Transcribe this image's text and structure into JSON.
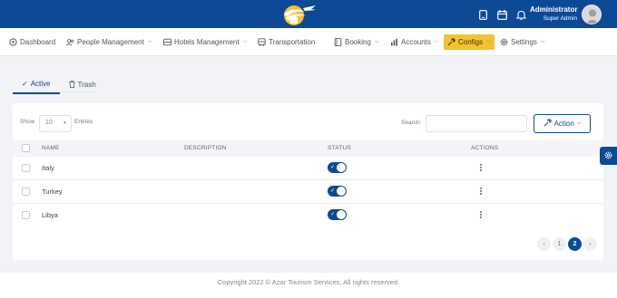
{
  "user": {
    "name": "Administrator",
    "role": "Super Admin"
  },
  "nav": {
    "dashboard": "Dashboard",
    "people": "People Management",
    "hotels": "Hotels Management",
    "transport": "Transportation",
    "booking": "Booking",
    "accounts": "Accounts",
    "configs": "Configs",
    "settings": "Settings"
  },
  "tabs": {
    "active": "Active",
    "trash": "Trash"
  },
  "table_controls": {
    "show_label": "Show",
    "show_value": "10",
    "entries_label": "Entries",
    "search_label": "Search:",
    "search_value": "",
    "action_label": "Action"
  },
  "columns": {
    "name": "NAME",
    "description": "DESCRIPTION",
    "status": "STATUS",
    "actions": "ACTIONS"
  },
  "rows": [
    {
      "name": "Italy",
      "description": "",
      "status": "on"
    },
    {
      "name": "Turkey",
      "description": "",
      "status": "on"
    },
    {
      "name": "Libya",
      "description": "",
      "status": "on"
    }
  ],
  "pagination": {
    "page1": "1",
    "page2": "2",
    "prev": "‹",
    "next": "›"
  },
  "footer": "Copyright 2022 © Azar Tourism Services, All rights reserved.",
  "colors": {
    "primary": "#0d4a96",
    "accent": "#f6c12f"
  }
}
